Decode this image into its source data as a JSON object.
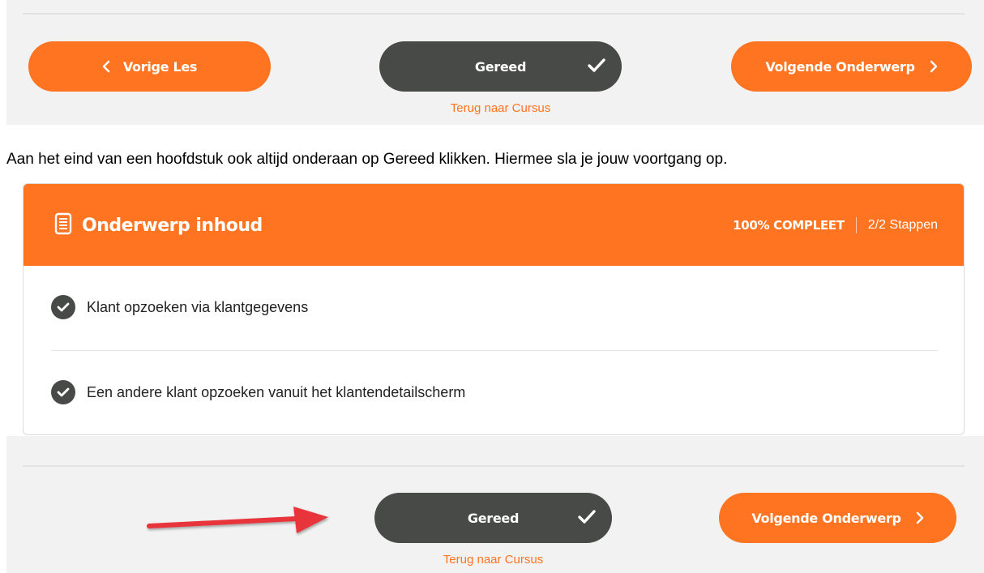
{
  "top_nav": {
    "prev_label": "Vorige Les",
    "done_label": "Gereed",
    "next_label": "Volgende Onderwerp",
    "back_link": "Terug naar Cursus"
  },
  "instruction": "Aan het eind van een hoofdstuk ook altijd onderaan op Gereed klikken. Hiermee sla je jouw voortgang op.",
  "topic_card": {
    "title": "Onderwerp inhoud",
    "progress_percent_label": "100% COMPLEET",
    "progress_steps_label": "2/2 Stappen",
    "items": [
      {
        "label": "Klant opzoeken via klantgegevens",
        "completed": true
      },
      {
        "label": "Een andere klant opzoeken vanuit het klantendetailscherm",
        "completed": true
      }
    ]
  },
  "bottom_nav": {
    "done_label": "Gereed",
    "next_label": "Volgende Onderwerp",
    "back_link": "Terug naar Cursus"
  },
  "colors": {
    "accent": "#ff7420",
    "dark_button": "#484a47",
    "annotation_arrow": "#e8363b"
  },
  "icons": [
    "chevron-left-icon",
    "checkmark-icon",
    "chevron-right-icon",
    "document-icon",
    "check-circle-icon",
    "red-arrow-icon"
  ]
}
